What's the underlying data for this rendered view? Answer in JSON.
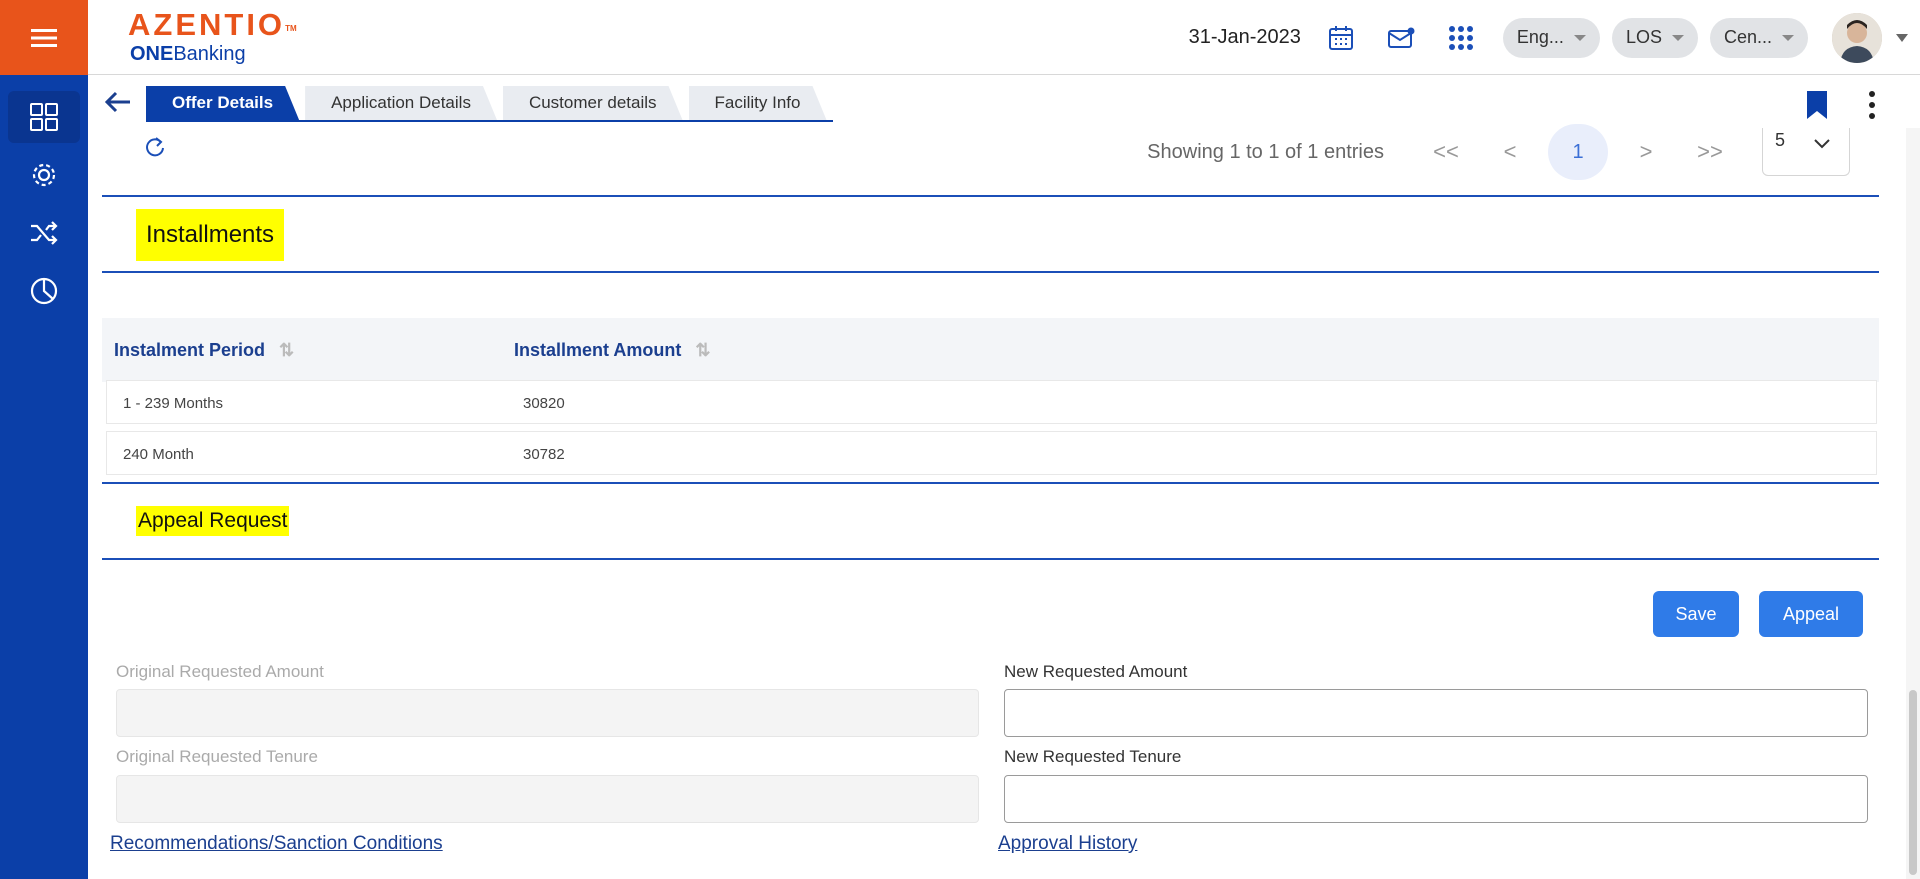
{
  "header": {
    "brand_name": "AZENTIO",
    "brand_tm": "TM",
    "brand_sub_bold": "ONE",
    "brand_sub_rest": "Banking",
    "date": "31-Jan-2023",
    "language": "Eng...",
    "module": "LOS",
    "branch": "Cen..."
  },
  "sidebar": {
    "items": [
      {
        "icon": "dashboard-grid-icon"
      },
      {
        "icon": "settings-gear-icon"
      },
      {
        "icon": "shuffle-icon"
      },
      {
        "icon": "pie-chart-icon"
      }
    ]
  },
  "tabs": [
    {
      "label": "Offer Details",
      "active": true
    },
    {
      "label": "Application Details",
      "active": false
    },
    {
      "label": "Customer details",
      "active": false
    },
    {
      "label": "Facility Info",
      "active": false
    }
  ],
  "pager": {
    "showing": "Showing 1 to 1 of 1 entries",
    "first": "<<",
    "prev": "<",
    "current_page": "1",
    "next": ">",
    "last": ">>",
    "page_size": "5"
  },
  "installments": {
    "title": "Installments",
    "columns": [
      "Instalment Period",
      "Installment Amount"
    ],
    "rows": [
      [
        "1 - 239 Months",
        "30820"
      ],
      [
        "240 Month",
        "30782"
      ]
    ]
  },
  "appeal": {
    "title": "Appeal Request",
    "save_label": "Save",
    "appeal_label": "Appeal",
    "original_amount_label": "Original Requested Amount",
    "new_amount_label": "New Requested Amount",
    "original_tenure_label": "Original Requested Tenure",
    "new_tenure_label": "New Requested Tenure",
    "original_amount_value": "",
    "new_amount_value": "",
    "original_tenure_value": "",
    "new_tenure_value": "",
    "recommendations_link": "Recommendations/Sanction Conditions",
    "approval_history_link": "Approval History"
  },
  "colors": {
    "accent_orange": "#e8541b",
    "primary_blue": "#0b3fa8",
    "button_blue": "#2f7be8",
    "highlight_yellow": "#ffff00"
  }
}
